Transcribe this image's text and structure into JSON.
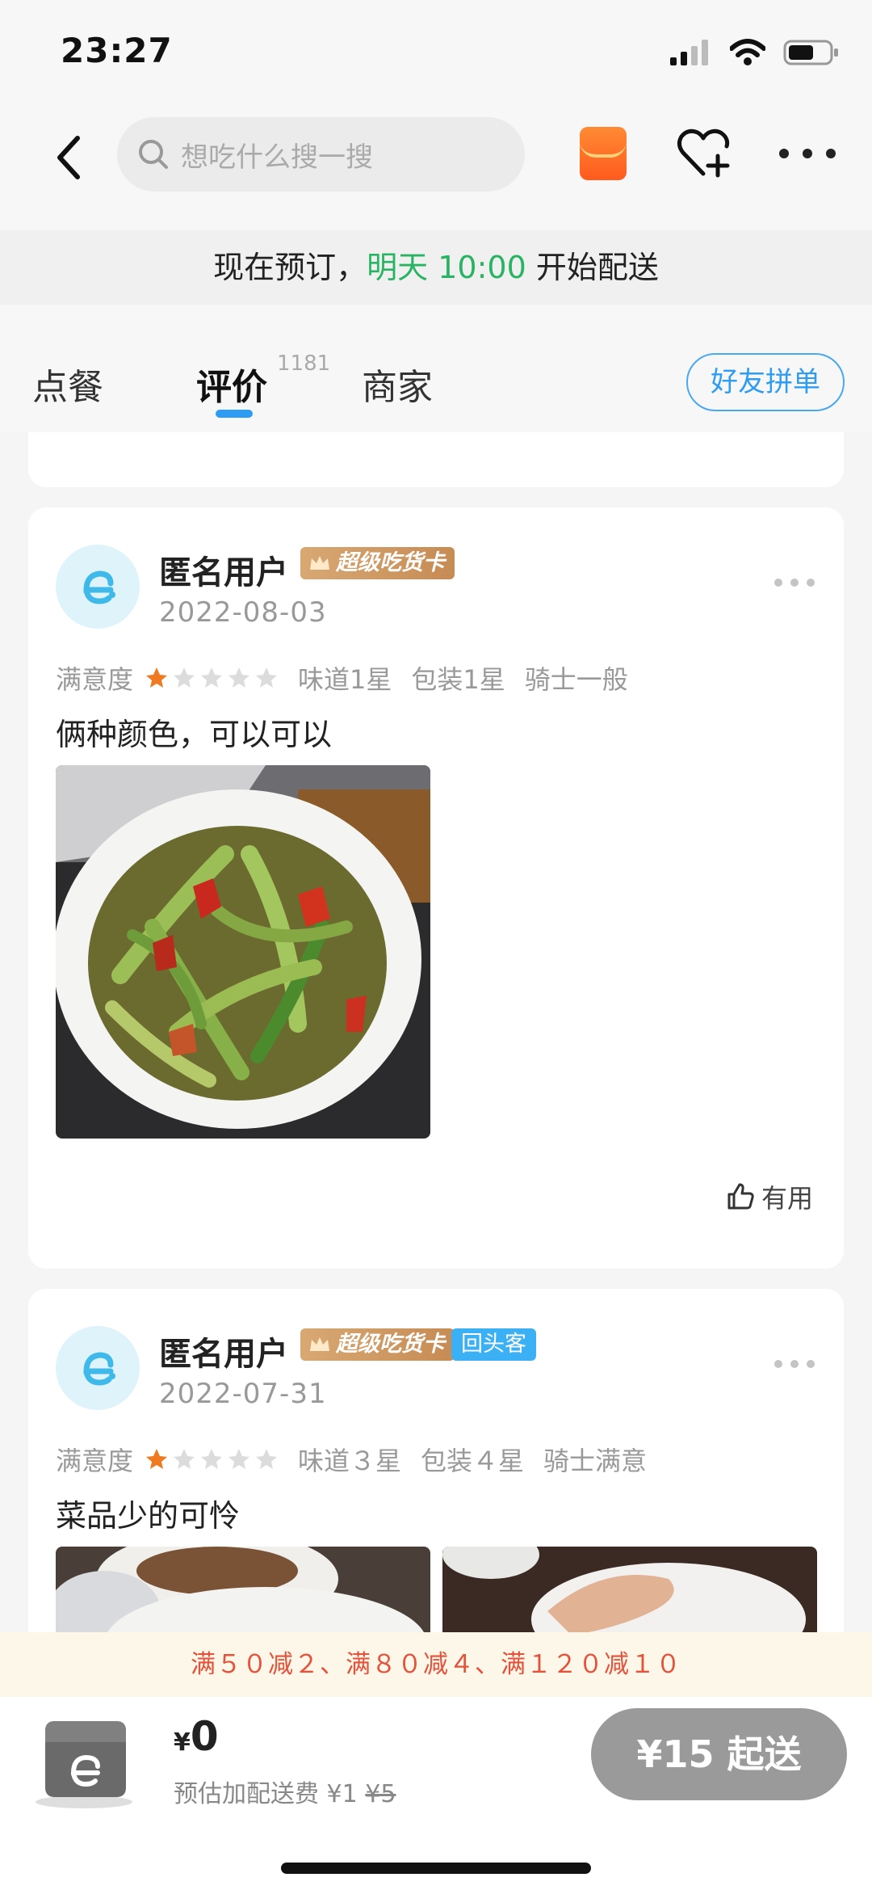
{
  "status_bar": {
    "time": "23:27"
  },
  "header": {
    "search_placeholder": "想吃什么搜一搜"
  },
  "notice": {
    "prefix": "现在预订，",
    "highlight": "明天 10:00",
    "suffix": " 开始配送"
  },
  "tabs": {
    "order": "点餐",
    "review": "评价",
    "review_count": "1181",
    "merchant": "商家",
    "group_order": "好友拼单"
  },
  "reviews": [
    {
      "user": "匿名用户",
      "vip_badge": "超级吃货卡",
      "date": "2022-08-03",
      "satisfaction_label": "满意度",
      "stars": 1,
      "taste": "味道1星",
      "packaging": "包装1星",
      "rider": "骑士一般",
      "text": "俩种颜色，可以可以",
      "useful_label": "有用"
    },
    {
      "user": "匿名用户",
      "vip_badge": "超级吃货卡",
      "return_badge": "回头客",
      "date": "2022-07-31",
      "satisfaction_label": "满意度",
      "stars": 1,
      "taste": "味道３星",
      "packaging": "包装４星",
      "rider": "骑士满意",
      "text": "菜品少的可怜"
    }
  ],
  "promo": {
    "text": "满５０减２、满８０减４、满１２０减１０"
  },
  "cart": {
    "currency": "¥",
    "amount": "0",
    "fee_prefix": "预估加配送费 ¥1 ",
    "fee_original": "¥5",
    "min_order": "¥15 起送"
  },
  "colors": {
    "accent_blue": "#2f9cf3",
    "star_orange": "#f07a22",
    "notice_green": "#28b463",
    "promo_red": "#e4523a"
  }
}
